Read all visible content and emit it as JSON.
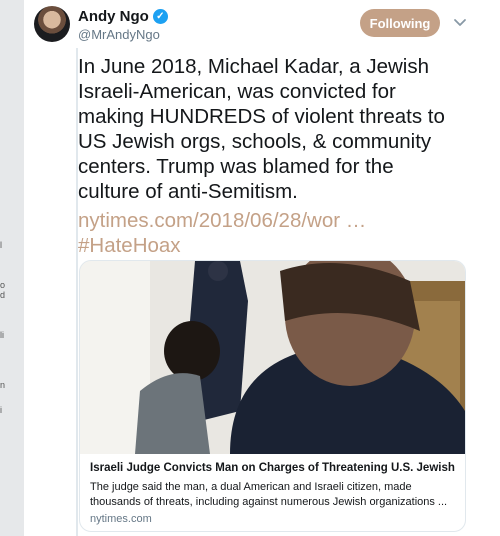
{
  "background": {
    "left_strip_marks": [
      "l",
      "o",
      "d",
      "li",
      "n",
      "i"
    ]
  },
  "tweet": {
    "author_name": "Andy Ngo",
    "author_handle": "@MrAndyNgo",
    "follow_label": "Following",
    "verified": true,
    "text_lines": [
      "In June 2018, Michael Kadar, a Jewish",
      "Israeli-American, was convicted for",
      "making HUNDREDS of violent threats to",
      "US Jewish orgs, schools, & community",
      "centers. Trump was blamed for the",
      "culture of anti-Semitism."
    ],
    "link_text": "nytimes.com/2018/06/28/wor …",
    "hashtag": "#HateHoax"
  },
  "card": {
    "title": "Israeli Judge Convicts Man on Charges of Threatening U.S. Jewish ...",
    "description_lines": [
      "The judge said the man, a dual American and Israeli citizen, made",
      "thousands of threats, including against numerous Jewish organizations ..."
    ],
    "domain": "nytimes.com"
  },
  "colors": {
    "accent": "#c4a187",
    "verified": "#1da1f2",
    "text": "#14171a",
    "secondary": "#657786"
  }
}
